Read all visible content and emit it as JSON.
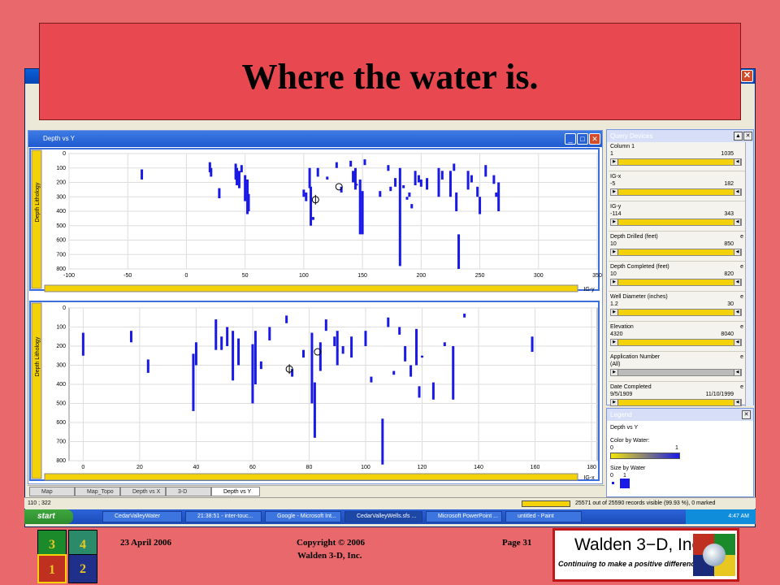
{
  "slide": {
    "title": "Where the water is.",
    "date": "23 April 2006",
    "copyright_line1": "Copyright © 2006",
    "copyright_line2": "Walden 3-D, Inc.",
    "page": "Page 31"
  },
  "nav_squares": [
    {
      "label": "3",
      "color": "#1a8a2a",
      "text": "#e8c820"
    },
    {
      "label": "4",
      "color": "#2a8a6a",
      "text": "#e8c820"
    },
    {
      "label": "1",
      "color": "#c03020",
      "text": "#e8c820"
    },
    {
      "label": "2",
      "color": "#20308a",
      "text": "#e8c820"
    }
  ],
  "logo": {
    "name": "Walden 3−D, Inc.",
    "tagline": "Continuing to make a positive difference!"
  },
  "chart_window": {
    "title": "Depth vs Y"
  },
  "chart_data": [
    {
      "type": "scatter",
      "title": "Depth vs Y",
      "ylabel": "Depth Lithology",
      "axis_selector": "IG-y",
      "xticks": [
        -100,
        -50,
        0,
        50,
        100,
        150,
        200,
        250,
        300,
        350
      ],
      "yticks": [
        0,
        100,
        200,
        300,
        400,
        500,
        600,
        700,
        800
      ],
      "xlim": [
        -100,
        350
      ],
      "ylim": [
        0,
        800
      ],
      "segments": [
        [
          -38,
          110,
          180
        ],
        [
          20,
          60,
          130
        ],
        [
          21,
          100,
          160
        ],
        [
          28,
          240,
          310
        ],
        [
          42,
          70,
          180
        ],
        [
          43,
          100,
          220
        ],
        [
          45,
          120,
          240
        ],
        [
          47,
          80,
          130
        ],
        [
          50,
          150,
          330
        ],
        [
          52,
          180,
          420
        ],
        [
          53,
          280,
          400
        ],
        [
          100,
          250,
          300
        ],
        [
          102,
          270,
          330
        ],
        [
          105,
          100,
          240
        ],
        [
          106,
          230,
          500
        ],
        [
          108,
          440,
          460
        ],
        [
          112,
          100,
          160
        ],
        [
          120,
          160,
          180
        ],
        [
          128,
          60,
          100
        ],
        [
          132,
          230,
          270
        ],
        [
          140,
          50,
          90
        ],
        [
          142,
          120,
          200
        ],
        [
          144,
          100,
          250
        ],
        [
          145,
          210,
          220
        ],
        [
          148,
          180,
          560
        ],
        [
          150,
          260,
          560
        ],
        [
          152,
          40,
          80
        ],
        [
          165,
          260,
          300
        ],
        [
          172,
          80,
          120
        ],
        [
          174,
          230,
          260
        ],
        [
          178,
          170,
          230
        ],
        [
          182,
          100,
          780
        ],
        [
          185,
          220,
          240
        ],
        [
          188,
          300,
          320
        ],
        [
          190,
          270,
          300
        ],
        [
          192,
          350,
          380
        ],
        [
          195,
          120,
          220
        ],
        [
          198,
          150,
          200
        ],
        [
          200,
          180,
          230
        ],
        [
          205,
          170,
          250
        ],
        [
          215,
          100,
          300
        ],
        [
          218,
          120,
          180
        ],
        [
          225,
          120,
          300
        ],
        [
          228,
          70,
          120
        ],
        [
          230,
          270,
          400
        ],
        [
          232,
          560,
          800
        ],
        [
          240,
          120,
          250
        ],
        [
          243,
          150,
          200
        ],
        [
          248,
          230,
          300
        ],
        [
          250,
          300,
          420
        ],
        [
          255,
          80,
          160
        ],
        [
          262,
          150,
          210
        ],
        [
          264,
          270,
          300
        ],
        [
          266,
          200,
          400
        ]
      ],
      "markers": [
        {
          "x": 110,
          "y": 320,
          "symbol": "circle-cross"
        },
        {
          "x": 130,
          "y": 230,
          "symbol": "ring"
        }
      ]
    },
    {
      "type": "scatter",
      "title": "Depth vs X",
      "ylabel": "Depth Lithology",
      "axis_selector": "IG-x",
      "xticks": [
        0,
        20,
        40,
        60,
        80,
        100,
        120,
        140,
        160,
        180
      ],
      "yticks": [
        0,
        100,
        200,
        300,
        400,
        500,
        600,
        700,
        800
      ],
      "xlim": [
        -5,
        182
      ],
      "ylim": [
        0,
        800
      ],
      "segments": [
        [
          0,
          130,
          250
        ],
        [
          17,
          120,
          180
        ],
        [
          23,
          270,
          340
        ],
        [
          39,
          240,
          540
        ],
        [
          40,
          180,
          300
        ],
        [
          47,
          60,
          220
        ],
        [
          49,
          150,
          220
        ],
        [
          51,
          100,
          200
        ],
        [
          53,
          120,
          380
        ],
        [
          55,
          160,
          300
        ],
        [
          60,
          190,
          500
        ],
        [
          61,
          120,
          400
        ],
        [
          63,
          280,
          320
        ],
        [
          66,
          100,
          170
        ],
        [
          72,
          40,
          80
        ],
        [
          74,
          320,
          360
        ],
        [
          78,
          220,
          260
        ],
        [
          81,
          130,
          500
        ],
        [
          82,
          390,
          680
        ],
        [
          84,
          180,
          330
        ],
        [
          86,
          60,
          120
        ],
        [
          89,
          150,
          200
        ],
        [
          90,
          120,
          300
        ],
        [
          92,
          200,
          240
        ],
        [
          95,
          150,
          260
        ],
        [
          100,
          120,
          200
        ],
        [
          102,
          360,
          390
        ],
        [
          106,
          580,
          820
        ],
        [
          108,
          50,
          100
        ],
        [
          110,
          330,
          350
        ],
        [
          112,
          100,
          140
        ],
        [
          114,
          200,
          280
        ],
        [
          116,
          300,
          360
        ],
        [
          118,
          110,
          300
        ],
        [
          119,
          410,
          470
        ],
        [
          120,
          250,
          260
        ],
        [
          124,
          390,
          480
        ],
        [
          128,
          180,
          200
        ],
        [
          131,
          200,
          480
        ],
        [
          135,
          30,
          50
        ],
        [
          159,
          150,
          230
        ]
      ],
      "markers": [
        {
          "x": 73,
          "y": 320,
          "symbol": "circle-cross"
        },
        {
          "x": 83,
          "y": 230,
          "symbol": "hook"
        }
      ]
    }
  ],
  "query_panel": {
    "title": "Query Devices",
    "items": [
      {
        "label": "Column 1",
        "e": "",
        "min": "1",
        "max": "1035",
        "bar": "yellow"
      },
      {
        "label": "IG-x",
        "e": "",
        "min": "-5",
        "max": "182",
        "bar": "yellow"
      },
      {
        "label": "IG-y",
        "e": "",
        "min": "-114",
        "max": "343",
        "bar": "yellow"
      },
      {
        "label": "Depth Drilled (feet)",
        "e": "e",
        "min": "10",
        "max": "850",
        "bar": "yellow"
      },
      {
        "label": "Depth Completed (feet)",
        "e": "e",
        "min": "10",
        "max": "820",
        "bar": "yellow"
      },
      {
        "label": "Well Diameter (inches)",
        "e": "e",
        "min": "1.2",
        "max": "30",
        "bar": "yellow"
      },
      {
        "label": "Elevation",
        "e": "e",
        "min": "4320",
        "max": "8040",
        "bar": "yellow"
      },
      {
        "label": "Application Number",
        "e": "e",
        "min": "(All)",
        "max": "",
        "bar": "grey"
      },
      {
        "label": "Date Completed",
        "e": "e",
        "min": "9/5/1909",
        "max": "11/10/1999",
        "bar": "yellow"
      }
    ]
  },
  "legend_panel": {
    "title": "Legend",
    "chart": "Depth vs Y",
    "color_label": "Color by Water:",
    "color_min": "0",
    "color_max": "1",
    "size_label": "Size by Water",
    "size_min": "0",
    "size_max": "1"
  },
  "tabs": [
    "Map",
    "Map_Topo",
    "Depth vs X",
    "3-D",
    "Depth vs Y"
  ],
  "status": {
    "coords": "110 ; 322",
    "records": "25571 out of 25590 records visible (99.93 %), 0 marked"
  },
  "taskbar": {
    "start": "start",
    "items": [
      "CedarValleyWater",
      "21:38:51 - inter-touc...",
      "Google - Microsoft Int...",
      "CedarValleyWells.sfs ...",
      "Microsoft PowerPoint ...",
      "untitled - Paint"
    ],
    "clock": "4:47 AM"
  },
  "colors": {
    "data": "#1a1ae6",
    "highlight": "#f3d20a",
    "slide_bg": "#e8686c"
  }
}
